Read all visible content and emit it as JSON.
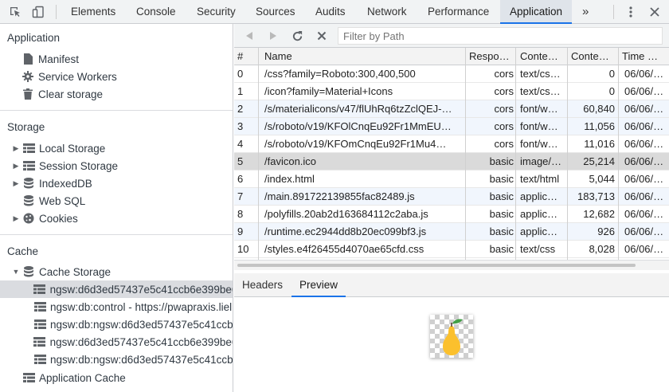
{
  "toolbar": {
    "tabs": [
      "Elements",
      "Console",
      "Security",
      "Sources",
      "Audits",
      "Network",
      "Performance",
      "Application"
    ],
    "more": "»"
  },
  "sidebar": {
    "application": {
      "title": "Application",
      "items": [
        "Manifest",
        "Service Workers",
        "Clear storage"
      ]
    },
    "storage": {
      "title": "Storage",
      "items": [
        "Local Storage",
        "Session Storage",
        "IndexedDB",
        "Web SQL",
        "Cookies"
      ]
    },
    "cache": {
      "title": "Cache",
      "cache_storage": "Cache Storage",
      "caches": [
        "ngsw:d6d3ed57437e5c41ccb6e399be6",
        "ngsw:db:control - https://pwapraxis.liel",
        "ngsw:db:ngsw:d6d3ed57437e5c41ccb",
        "ngsw:d6d3ed57437e5c41ccb6e399be6",
        "ngsw:db:ngsw:d6d3ed57437e5c41ccb"
      ],
      "app_cache": "Application Cache"
    }
  },
  "filter": {
    "placeholder": "Filter by Path"
  },
  "table": {
    "columns": [
      "#",
      "Name",
      "Respo…",
      "Conte…",
      "Conte…",
      "Time …"
    ],
    "rows": [
      [
        "0",
        "/css?family=Roboto:300,400,500",
        "cors",
        "text/cs…",
        "0",
        "06/06/…"
      ],
      [
        "1",
        "/icon?family=Material+Icons",
        "cors",
        "text/cs…",
        "0",
        "06/06/…"
      ],
      [
        "2",
        "/s/materialicons/v47/flUhRq6tzZclQEJ-…",
        "cors",
        "font/w…",
        "60,840",
        "06/06/…"
      ],
      [
        "3",
        "/s/roboto/v19/KFOlCnqEu92Fr1MmEU…",
        "cors",
        "font/w…",
        "11,056",
        "06/06/…"
      ],
      [
        "4",
        "/s/roboto/v19/KFOmCnqEu92Fr1Mu4…",
        "cors",
        "font/w…",
        "11,016",
        "06/06/…"
      ],
      [
        "5",
        "/favicon.ico",
        "basic",
        "image/…",
        "25,214",
        "06/06/…"
      ],
      [
        "6",
        "/index.html",
        "basic",
        "text/html",
        "5,044",
        "06/06/…"
      ],
      [
        "7",
        "/main.891722139855fac82489.js",
        "basic",
        "applic…",
        "183,713",
        "06/06/…"
      ],
      [
        "8",
        "/polyfills.20ab2d163684112c2aba.js",
        "basic",
        "applic…",
        "12,682",
        "06/06/…"
      ],
      [
        "9",
        "/runtime.ec2944dd8b20ec099bf3.js",
        "basic",
        "applic…",
        "926",
        "06/06/…"
      ],
      [
        "10",
        "/styles.e4f26455d4070ae65cfd.css",
        "basic",
        "text/css",
        "8,028",
        "06/06/…"
      ]
    ],
    "selected_row": 5
  },
  "detail": {
    "tabs": [
      "Headers",
      "Preview"
    ],
    "active_tab": "Preview"
  },
  "colors": {
    "accent": "#1a73e8",
    "pear_yellow": "#fbc02d",
    "pear_leaf": "#43a047"
  }
}
